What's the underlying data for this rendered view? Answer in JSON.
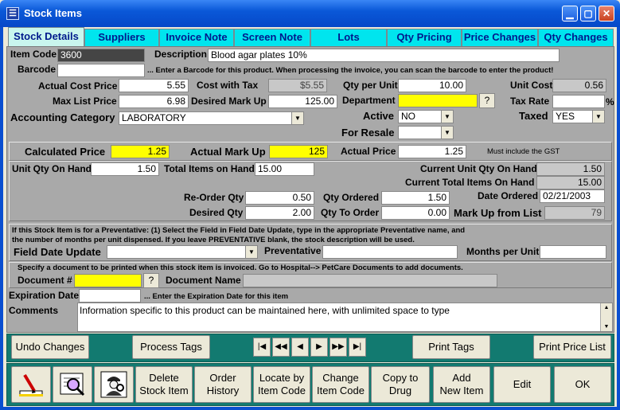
{
  "window": {
    "title": "Stock Items",
    "app_icon": "grid-icon",
    "controls": [
      "minimize",
      "maximize",
      "close"
    ]
  },
  "tabs": [
    {
      "label": "Stock Details",
      "active": true
    },
    {
      "label": "Suppliers"
    },
    {
      "label": "Invoice Note"
    },
    {
      "label": "Screen Note"
    },
    {
      "label": "Lots"
    },
    {
      "label": "Qty Pricing"
    },
    {
      "label": "Price Changes"
    },
    {
      "label": "Qty Changes"
    }
  ],
  "item": {
    "item_code_label": "Item Code",
    "item_code": "3600",
    "description_label": "Description",
    "description": "Blood agar plates 10%",
    "barcode_label": "Barcode",
    "barcode": "",
    "barcode_hint": "... Enter a Barcode for this product.  When processing the invoice, you can scan the barcode to enter the product!"
  },
  "pricing": {
    "actual_cost_price_label": "Actual Cost Price",
    "actual_cost_price": "5.55",
    "cost_with_tax_label": "Cost with Tax",
    "cost_with_tax": "$5.55",
    "qty_per_unit_label": "Qty per Unit",
    "qty_per_unit": "10.00",
    "unit_cost_label": "Unit Cost",
    "unit_cost": "0.56",
    "max_list_price_label": "Max List Price",
    "max_list_price": "6.98",
    "desired_mark_up_label": "Desired Mark Up",
    "desired_mark_up": "125.00",
    "department_label": "Department",
    "department": "",
    "lookup_label": "?",
    "tax_rate_label": "Tax Rate",
    "tax_rate": "",
    "tax_rate_unit": "%",
    "accounting_category_label": "Accounting Category",
    "accounting_category": "LABORATORY",
    "active_label": "Active",
    "active": "NO",
    "taxed_label": "Taxed",
    "taxed": "YES",
    "for_resale_label": "For Resale",
    "for_resale": ""
  },
  "calc": {
    "calculated_price_label": "Calculated Price",
    "calculated_price": "1.25",
    "actual_mark_up_label": "Actual Mark Up",
    "actual_mark_up": "125",
    "actual_price_label": "Actual Price",
    "actual_price": "1.25",
    "gst_note": "Must include the GST"
  },
  "stock": {
    "unit_qty_on_hand_label": "Unit Qty On Hand",
    "unit_qty_on_hand": "1.50",
    "total_items_on_hand_label": "Total Items on Hand",
    "total_items_on_hand": "15.00",
    "current_unit_qty_label": "Current Unit Qty On Hand",
    "current_unit_qty": "1.50",
    "current_total_items_label": "Current Total Items On Hand",
    "current_total_items": "15.00",
    "reorder_qty_label": "Re-Order Qty",
    "reorder_qty": "0.50",
    "qty_ordered_label": "Qty Ordered",
    "qty_ordered": "1.50",
    "date_ordered_label": "Date Ordered",
    "date_ordered": "02/21/2003",
    "desired_qty_label": "Desired Qty",
    "desired_qty": "2.00",
    "qty_to_order_label": "Qty To Order",
    "qty_to_order": "0.00",
    "mark_up_from_list_label": "Mark Up from List",
    "mark_up_from_list": "79"
  },
  "preventative": {
    "note_line1": "If this Stock Item is for a Preventative: (1) Select the Field in Field Date Update, type in the appropriate Preventative name, and",
    "note_line2": "the number of months per unit dispensed.  If you leave PREVENTATIVE blank, the stock description will be used.",
    "field_date_update_label": "Field Date Update",
    "field_date_update": "",
    "preventative_label": "Preventative",
    "preventative": "",
    "months_per_unit_label": "Months per Unit",
    "months_per_unit": ""
  },
  "document": {
    "note": "Specify a document to be printed when this stock item is invoiced.  Go to Hospital--> PetCare Documents to add documents.",
    "document_no_label": "Document #",
    "document_no": "",
    "lookup_label": "?",
    "document_name_label": "Document Name",
    "document_name": ""
  },
  "expiration": {
    "label": "Expiration Date",
    "value": "",
    "hint": "... Enter the Expiration Date for this item"
  },
  "comments": {
    "label": "Comments",
    "value": "Information specific to this product can be maintained here, with unlimited space to type"
  },
  "toolbar1": {
    "undo_changes": "Undo Changes",
    "process_tags": "Process Tags",
    "nav_first": "first-record-icon",
    "nav_prev_page": "prev-page-icon",
    "nav_prev": "prev-record-icon",
    "nav_next": "next-record-icon",
    "nav_next_page": "next-page-icon",
    "nav_last": "last-record-icon",
    "print_tags": "Print Tags",
    "print_price_list": "Print Price List"
  },
  "toolbar2": {
    "delete_line1": "Delete",
    "delete_line2": "Stock Item",
    "order_line1": "Order",
    "order_line2": "History",
    "locate_line1": "Locate by",
    "locate_line2": "Item Code",
    "change_line1": "Change",
    "change_line2": "Item Code",
    "copy_line1": "Copy to",
    "copy_line2": "Drug",
    "add_line1": "Add",
    "add_line2": "New Item",
    "edit": "Edit",
    "ok": "OK"
  },
  "colors": {
    "tab": "#00e5ee",
    "tab_text": "#00198c",
    "panel": "#a9a9a9",
    "highlight": "#ffff00",
    "toolbar": "#127a70",
    "titlebar": "#0a58d8"
  }
}
